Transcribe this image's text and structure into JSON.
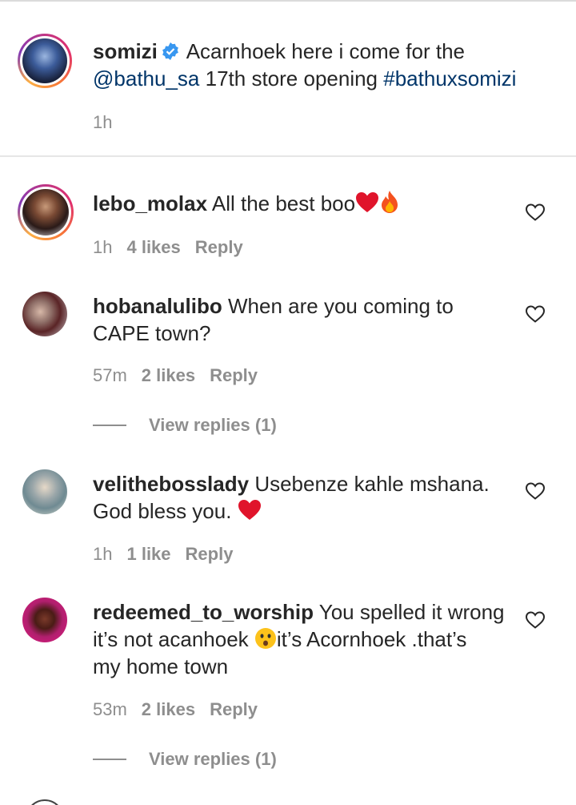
{
  "post": {
    "username": "somizi",
    "caption_before": "Acarnhoek here i come for the",
    "mention": "@bathu_sa",
    "caption_mid": "17th store opening",
    "hashtag": "#bathuxsomizi",
    "time": "1h"
  },
  "comments": [
    {
      "username": "lebo_molax",
      "text": "All the best boo",
      "emojis": [
        "red-heart",
        "fire"
      ],
      "time": "1h",
      "likes": "4 likes",
      "reply_label": "Reply"
    },
    {
      "username": "hobanalulibo",
      "text_line1": "When are you coming to",
      "text_line2": "CAPE town?",
      "time": "57m",
      "likes": "2 likes",
      "reply_label": "Reply",
      "view_replies": "View replies (1)"
    },
    {
      "username": "velithebosslady",
      "text_line1": "Usebenze kahle mshana.",
      "text_line2": "God bless you.",
      "emojis": [
        "red-heart"
      ],
      "time": "1h",
      "likes": "1 like",
      "reply_label": "Reply"
    },
    {
      "username": "redeemed_to_worship",
      "text_line1": "You spelled it wrong",
      "text_line2a": "it’s not acanhoek",
      "text_line2b": "it’s Acornhoek .that’s",
      "text_line3": "my home town",
      "emojis": [
        "hushed-face"
      ],
      "time": "53m",
      "likes": "2 likes",
      "reply_label": "Reply",
      "view_replies": "View replies (1)"
    }
  ],
  "colors": {
    "link": "#003569",
    "meta": "#8e8e8e",
    "heart_emoji": "#e0142b",
    "verified": "#3897f0"
  }
}
